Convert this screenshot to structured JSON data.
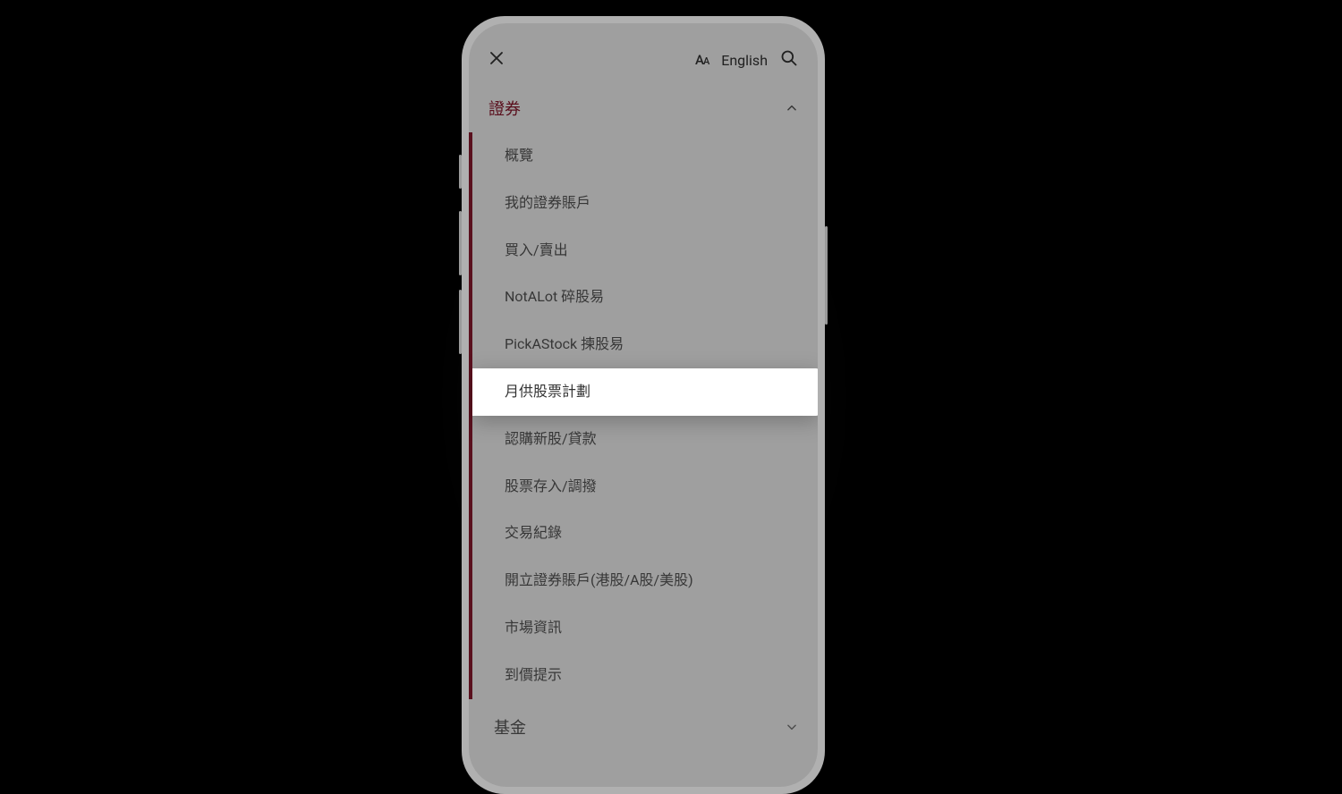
{
  "topBar": {
    "languageLabel": "English"
  },
  "section": {
    "title": "證券"
  },
  "menu": {
    "items": [
      {
        "label": "概覽",
        "highlighted": false
      },
      {
        "label": "我的證券賬戶",
        "highlighted": false
      },
      {
        "label": "買入/賣出",
        "highlighted": false
      },
      {
        "label": "NotALot 碎股易",
        "highlighted": false
      },
      {
        "label": "PickAStock 揀股易",
        "highlighted": false
      },
      {
        "label": "月供股票計劃",
        "highlighted": true
      },
      {
        "label": "認購新股/貸款",
        "highlighted": false
      },
      {
        "label": "股票存入/調撥",
        "highlighted": false
      },
      {
        "label": "交易紀錄",
        "highlighted": false
      },
      {
        "label": "開立證券賬戶(港股/A股/美股)",
        "highlighted": false
      },
      {
        "label": "市場資訊",
        "highlighted": false
      },
      {
        "label": "到價提示",
        "highlighted": false
      }
    ]
  },
  "nextSection": {
    "title": "基金"
  }
}
